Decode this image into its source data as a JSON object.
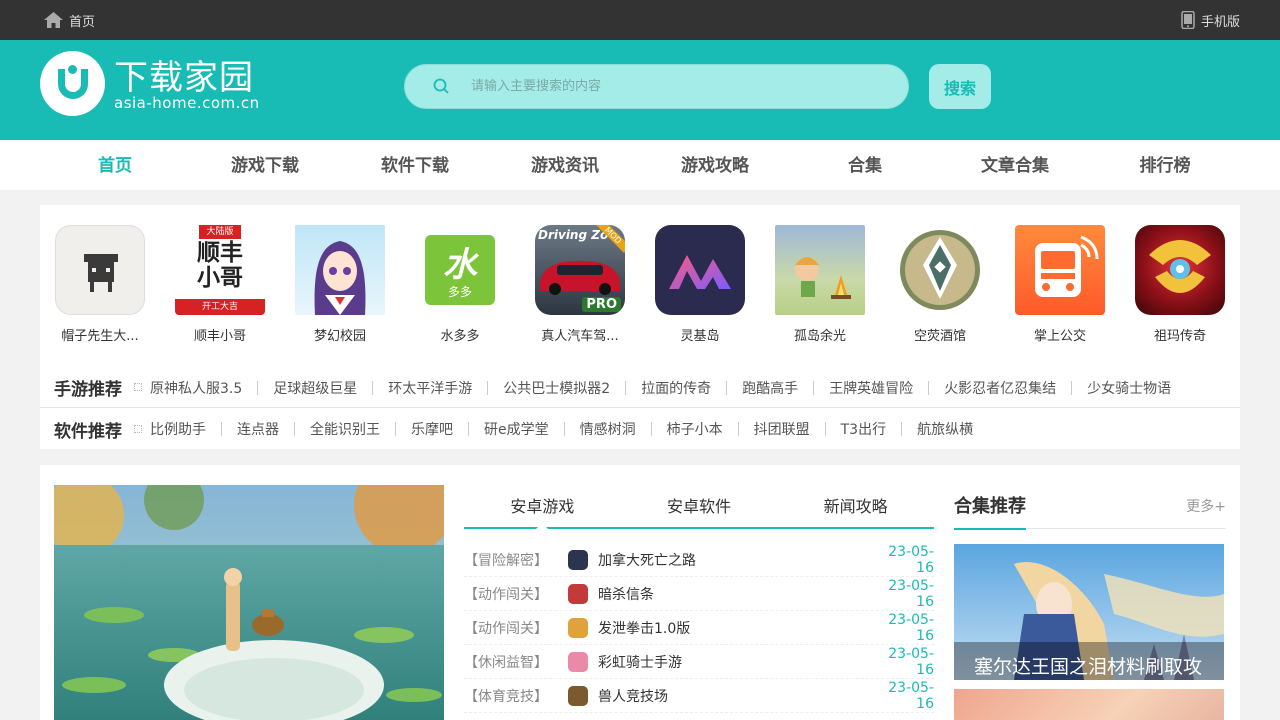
{
  "topbar": {
    "home_label": "首页",
    "mobile_label": "手机版"
  },
  "header": {
    "logo_title": "下载家园",
    "logo_sub": "asia-home.com.cn",
    "search_placeholder": "请输入主要搜索的内容",
    "search_button": "搜索",
    "accent_color": "#19bcb4"
  },
  "nav": {
    "items": [
      {
        "label": "首页",
        "active": true
      },
      {
        "label": "游戏下载"
      },
      {
        "label": "软件下载"
      },
      {
        "label": "游戏资讯"
      },
      {
        "label": "游戏攻略"
      },
      {
        "label": "合集"
      },
      {
        "label": "文章合集"
      },
      {
        "label": "排行榜"
      }
    ]
  },
  "apps": [
    {
      "name": "帽子先生大...",
      "icon": "hat-man-icon"
    },
    {
      "name": "顺丰小哥",
      "icon": "shunfeng-icon",
      "icon_text_top": "大陆版",
      "icon_text_main": "顺丰\n小哥",
      "icon_text_bottom": "开工大吉"
    },
    {
      "name": "梦幻校园",
      "icon": "anime-girl-icon"
    },
    {
      "name": "水多多",
      "icon": "water-icon",
      "icon_text_main": "水",
      "icon_text_bottom": "多多"
    },
    {
      "name": "真人汽车驾...",
      "icon": "car-icon",
      "icon_text_top": "Driving Zo",
      "icon_text_badge": "MOD",
      "icon_text_bottom": "PRO"
    },
    {
      "name": "灵基岛",
      "icon": "mountain-logo-icon"
    },
    {
      "name": "孤岛余光",
      "icon": "campfire-icon"
    },
    {
      "name": "空荧酒馆",
      "icon": "compass-icon"
    },
    {
      "name": "掌上公交",
      "icon": "bus-icon"
    },
    {
      "name": "祖玛传奇",
      "icon": "zuma-icon"
    }
  ],
  "game_rec": {
    "title": "手游推荐",
    "links": [
      "原神私人服3.5",
      "足球超级巨星",
      "环太平洋手游",
      "公共巴士模拟器2",
      "拉面的传奇",
      "跑酷高手",
      "王牌英雄冒险",
      "火影忍者亿忍集结",
      "少女骑士物语"
    ]
  },
  "soft_rec": {
    "title": "软件推荐",
    "links": [
      "比例助手",
      "连点器",
      "全能识别王",
      "乐摩吧",
      "研e成学堂",
      "情感树洞",
      "柿子小本",
      "抖团联盟",
      "T3出行",
      "航旅纵横"
    ]
  },
  "tabs": [
    "安卓游戏",
    "安卓软件",
    "新闻攻略"
  ],
  "news": [
    {
      "cat": "【冒险解密】",
      "title": "加拿大死亡之路",
      "date": "23-05-16",
      "color": "#2b3550"
    },
    {
      "cat": "【动作闯关】",
      "title": "暗杀信条",
      "date": "23-05-16",
      "color": "#c23a3a"
    },
    {
      "cat": "【动作闯关】",
      "title": "发泄拳击1.0版",
      "date": "23-05-16",
      "color": "#e0a33c"
    },
    {
      "cat": "【休闲益智】",
      "title": "彩虹骑士手游",
      "date": "23-05-16",
      "color": "#e98aa9"
    },
    {
      "cat": "【体育竞技】",
      "title": "兽人竞技场",
      "date": "23-05-16",
      "color": "#7a5a2e"
    }
  ],
  "collections": {
    "title": "合集推荐",
    "more": "更多+",
    "items": [
      {
        "caption": "塞尔达王国之泪材料刷取攻"
      }
    ]
  }
}
